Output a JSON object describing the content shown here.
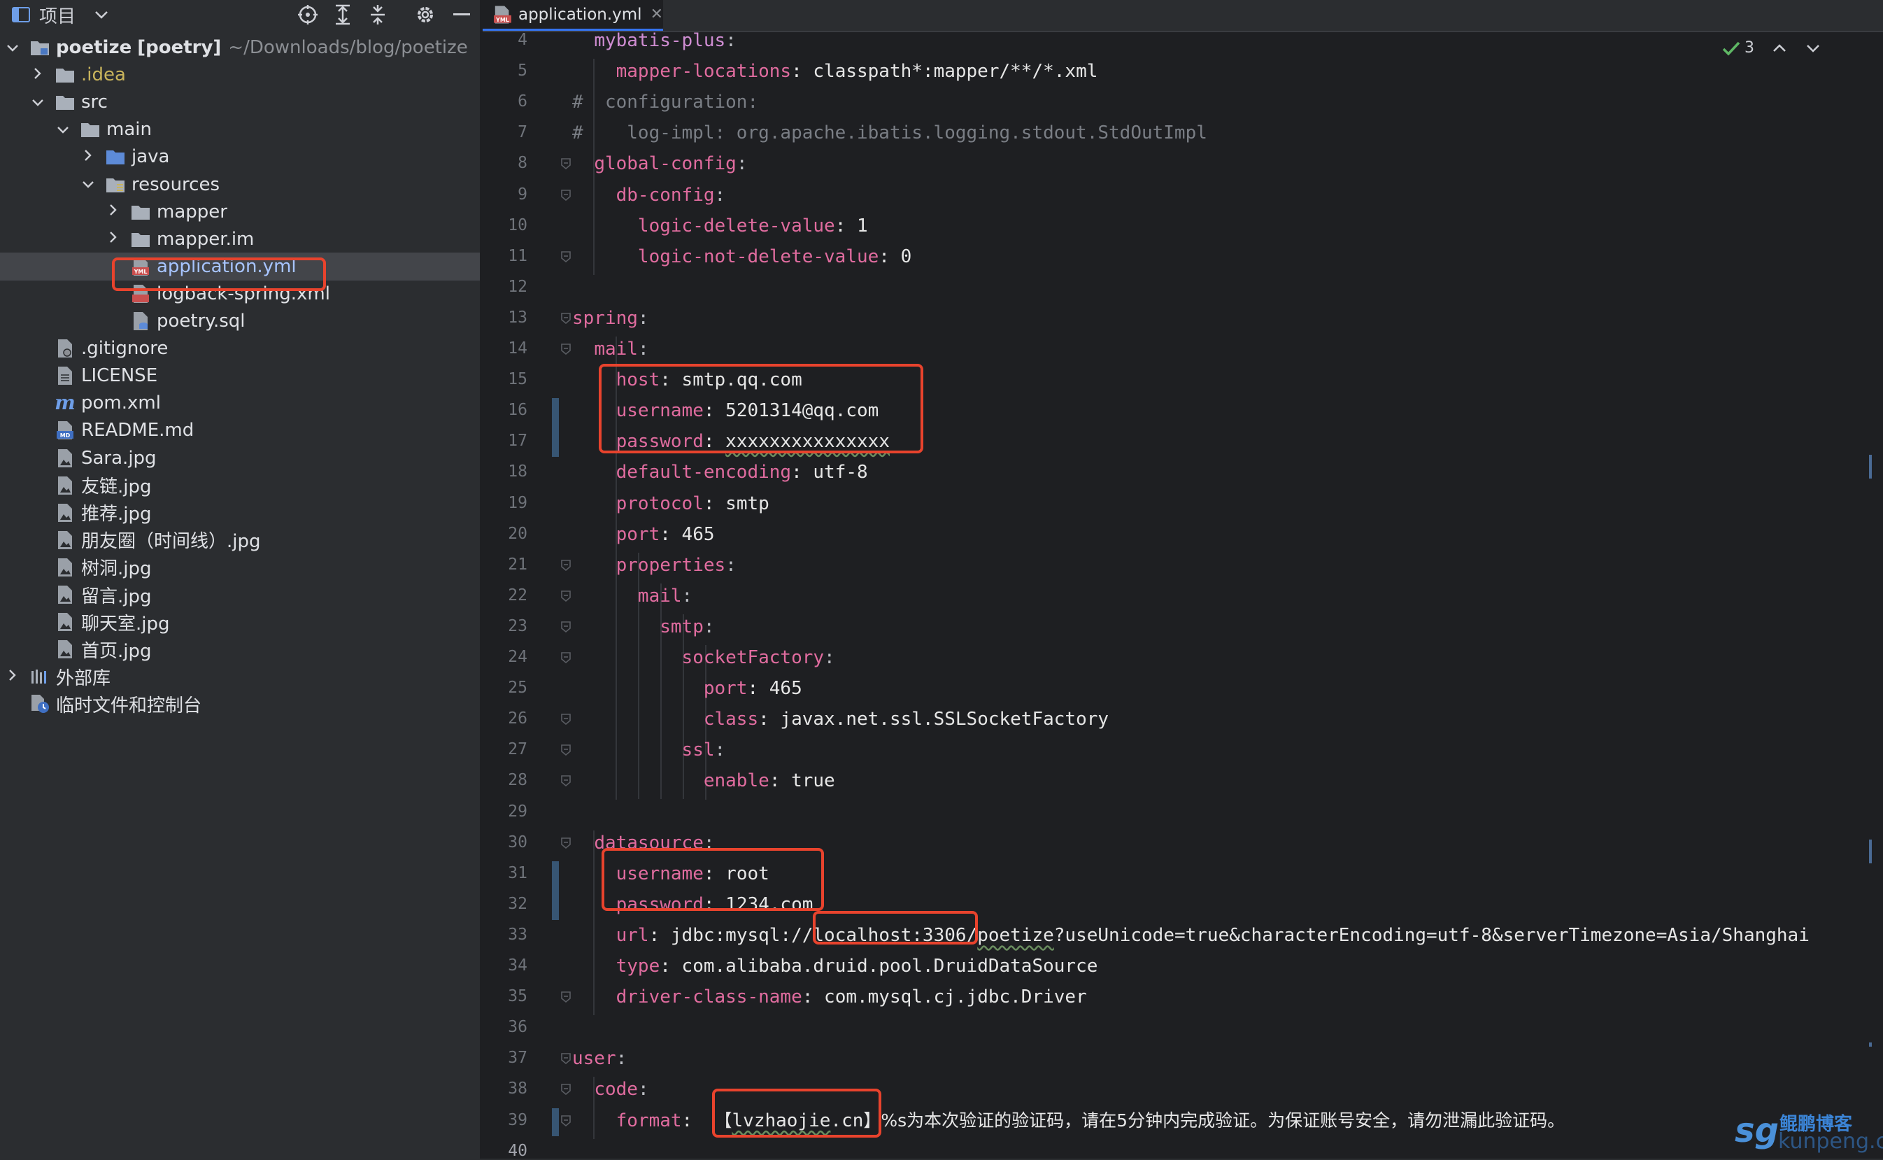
{
  "project_panel": {
    "title": "项目",
    "tree": [
      {
        "label": "poetize",
        "module": "[poetry]",
        "path": "~/Downloads/blog/poetize",
        "depth": 0,
        "expanded": true,
        "icon": "module-folder-icon"
      },
      {
        "label": ".idea",
        "depth": 1,
        "expanded": false,
        "icon": "folder-icon"
      },
      {
        "label": "src",
        "depth": 1,
        "expanded": true,
        "icon": "folder-icon"
      },
      {
        "label": "main",
        "depth": 2,
        "expanded": true,
        "icon": "folder-icon"
      },
      {
        "label": "java",
        "depth": 3,
        "expanded": false,
        "icon": "source-folder-icon"
      },
      {
        "label": "resources",
        "depth": 3,
        "expanded": true,
        "icon": "resources-folder-icon"
      },
      {
        "label": "mapper",
        "depth": 4,
        "expanded": false,
        "icon": "folder-icon"
      },
      {
        "label": "mapper.im",
        "depth": 4,
        "expanded": false,
        "icon": "folder-icon"
      },
      {
        "label": "application.yml",
        "depth": 4,
        "leaf": true,
        "icon": "yml-file-icon",
        "selected": true
      },
      {
        "label": "logback-spring.xml",
        "depth": 4,
        "leaf": true,
        "icon": "xml-file-icon"
      },
      {
        "label": "poetry.sql",
        "depth": 4,
        "leaf": true,
        "icon": "sql-file-icon"
      },
      {
        "label": ".gitignore",
        "depth": 1,
        "leaf": true,
        "icon": "gitignore-file-icon"
      },
      {
        "label": "LICENSE",
        "depth": 1,
        "leaf": true,
        "icon": "text-file-icon"
      },
      {
        "label": "pom.xml",
        "depth": 1,
        "leaf": true,
        "icon": "maven-file-icon"
      },
      {
        "label": "README.md",
        "depth": 1,
        "leaf": true,
        "icon": "markdown-file-icon"
      },
      {
        "label": "Sara.jpg",
        "depth": 1,
        "leaf": true,
        "icon": "image-file-icon"
      },
      {
        "label": "友链.jpg",
        "depth": 1,
        "leaf": true,
        "icon": "image-file-icon"
      },
      {
        "label": "推荐.jpg",
        "depth": 1,
        "leaf": true,
        "icon": "image-file-icon"
      },
      {
        "label": "朋友圈（时间线）.jpg",
        "depth": 1,
        "leaf": true,
        "icon": "image-file-icon"
      },
      {
        "label": "树洞.jpg",
        "depth": 1,
        "leaf": true,
        "icon": "image-file-icon"
      },
      {
        "label": "留言.jpg",
        "depth": 1,
        "leaf": true,
        "icon": "image-file-icon"
      },
      {
        "label": "聊天室.jpg",
        "depth": 1,
        "leaf": true,
        "icon": "image-file-icon"
      },
      {
        "label": "首页.jpg",
        "depth": 1,
        "leaf": true,
        "icon": "image-file-icon"
      },
      {
        "label": "外部库",
        "depth": 0,
        "expanded": false,
        "icon": "library-icon"
      },
      {
        "label": "临时文件和控制台",
        "depth": 0,
        "leaf": true,
        "icon": "scratch-icon"
      }
    ]
  },
  "editor": {
    "tab_label": "application.yml",
    "inspection_count": "3",
    "first_line": 4,
    "current_line": 40,
    "lines": [
      [
        {
          "t": "  ",
          "c": ""
        },
        {
          "t": "mybatis-plus",
          "c": "k"
        },
        {
          "t": ":",
          "c": ""
        }
      ],
      [
        {
          "t": "    ",
          "c": ""
        },
        {
          "t": "mapper-locations",
          "c": "k2"
        },
        {
          "t": ": classpath*:mapper/**/*.xml",
          "c": "v"
        }
      ],
      [
        {
          "t": "#  configuration:",
          "c": "c"
        }
      ],
      [
        {
          "t": "#    log-impl: org.apache.ibatis.logging.stdout.StdOutImpl",
          "c": "c"
        }
      ],
      [
        {
          "t": "  ",
          "c": ""
        },
        {
          "t": "global-config",
          "c": "k2"
        },
        {
          "t": ":",
          "c": ""
        }
      ],
      [
        {
          "t": "    ",
          "c": ""
        },
        {
          "t": "db-config",
          "c": "k2"
        },
        {
          "t": ":",
          "c": ""
        }
      ],
      [
        {
          "t": "      ",
          "c": ""
        },
        {
          "t": "logic-delete-value",
          "c": "k2"
        },
        {
          "t": ": 1",
          "c": "v"
        }
      ],
      [
        {
          "t": "      ",
          "c": ""
        },
        {
          "t": "logic-not-delete-value",
          "c": "k2"
        },
        {
          "t": ": 0",
          "c": "v"
        }
      ],
      [
        {
          "t": "",
          "c": ""
        }
      ],
      [
        {
          "t": "spring",
          "c": "k2"
        },
        {
          "t": ":",
          "c": ""
        }
      ],
      [
        {
          "t": "  ",
          "c": ""
        },
        {
          "t": "mail",
          "c": "k2"
        },
        {
          "t": ":",
          "c": ""
        }
      ],
      [
        {
          "t": "    ",
          "c": ""
        },
        {
          "t": "host",
          "c": "k2"
        },
        {
          "t": ": smtp.qq.com",
          "c": "v"
        }
      ],
      [
        {
          "t": "    ",
          "c": ""
        },
        {
          "t": "username",
          "c": "k2"
        },
        {
          "t": ": 5201314@qq.com",
          "c": "v"
        }
      ],
      [
        {
          "t": "    ",
          "c": ""
        },
        {
          "t": "password",
          "c": "k2"
        },
        {
          "t": ": ",
          "c": "v"
        },
        {
          "t": "xxxxxxxxxxxxxxx",
          "c": "v wavy"
        }
      ],
      [
        {
          "t": "    ",
          "c": ""
        },
        {
          "t": "default-encoding",
          "c": "k2"
        },
        {
          "t": ": utf-8",
          "c": "v"
        }
      ],
      [
        {
          "t": "    ",
          "c": ""
        },
        {
          "t": "protocol",
          "c": "k2"
        },
        {
          "t": ": smtp",
          "c": "v"
        }
      ],
      [
        {
          "t": "    ",
          "c": ""
        },
        {
          "t": "port",
          "c": "k2"
        },
        {
          "t": ": 465",
          "c": "v"
        }
      ],
      [
        {
          "t": "    ",
          "c": ""
        },
        {
          "t": "properties",
          "c": "k2"
        },
        {
          "t": ":",
          "c": ""
        }
      ],
      [
        {
          "t": "      ",
          "c": ""
        },
        {
          "t": "mail",
          "c": "k2"
        },
        {
          "t": ":",
          "c": ""
        }
      ],
      [
        {
          "t": "        ",
          "c": ""
        },
        {
          "t": "smtp",
          "c": "k2"
        },
        {
          "t": ":",
          "c": ""
        }
      ],
      [
        {
          "t": "          ",
          "c": ""
        },
        {
          "t": "socketFactory",
          "c": "k2"
        },
        {
          "t": ":",
          "c": ""
        }
      ],
      [
        {
          "t": "            ",
          "c": ""
        },
        {
          "t": "port",
          "c": "k2"
        },
        {
          "t": ": 465",
          "c": "v"
        }
      ],
      [
        {
          "t": "            ",
          "c": ""
        },
        {
          "t": "class",
          "c": "k2"
        },
        {
          "t": ": javax.net.ssl.SSLSocketFactory",
          "c": "v"
        }
      ],
      [
        {
          "t": "          ",
          "c": ""
        },
        {
          "t": "ssl",
          "c": "k2"
        },
        {
          "t": ":",
          "c": ""
        }
      ],
      [
        {
          "t": "            ",
          "c": ""
        },
        {
          "t": "enable",
          "c": "k2"
        },
        {
          "t": ": true",
          "c": "v"
        }
      ],
      [
        {
          "t": "",
          "c": ""
        }
      ],
      [
        {
          "t": "  ",
          "c": ""
        },
        {
          "t": "datasource",
          "c": "k2"
        },
        {
          "t": ":",
          "c": ""
        }
      ],
      [
        {
          "t": "    ",
          "c": ""
        },
        {
          "t": "username",
          "c": "k2"
        },
        {
          "t": ": root",
          "c": "v"
        }
      ],
      [
        {
          "t": "    ",
          "c": ""
        },
        {
          "t": "password",
          "c": "k2"
        },
        {
          "t": ": 1234.com",
          "c": "v"
        }
      ],
      [
        {
          "t": "    ",
          "c": ""
        },
        {
          "t": "url",
          "c": "k2"
        },
        {
          "t": ": jdbc:mysql://localhost:3306/",
          "c": "v"
        },
        {
          "t": "poetize",
          "c": "v wavy"
        },
        {
          "t": "?useUnicode=true&characterEncoding=utf-8&serverTimezone=Asia/Shanghai",
          "c": "v"
        }
      ],
      [
        {
          "t": "    ",
          "c": ""
        },
        {
          "t": "type",
          "c": "k2"
        },
        {
          "t": ": com.alibaba.druid.pool.DruidDataSource",
          "c": "v"
        }
      ],
      [
        {
          "t": "    ",
          "c": ""
        },
        {
          "t": "driver-class-name",
          "c": "k2"
        },
        {
          "t": ": com.mysql.cj.jdbc.Driver",
          "c": "v"
        }
      ],
      [
        {
          "t": "",
          "c": ""
        }
      ],
      [
        {
          "t": "user",
          "c": "k2"
        },
        {
          "t": ":",
          "c": ""
        }
      ],
      [
        {
          "t": "  ",
          "c": ""
        },
        {
          "t": "code",
          "c": "k2"
        },
        {
          "t": ":",
          "c": ""
        }
      ],
      [
        {
          "t": "    ",
          "c": ""
        },
        {
          "t": "format",
          "c": "k2"
        },
        {
          "t": ":  ",
          "c": "v"
        },
        {
          "t": "【",
          "c": "v cn"
        },
        {
          "t": "lvzhaojie",
          "c": "v wavy"
        },
        {
          "t": ".cn",
          "c": "v"
        },
        {
          "t": "】",
          "c": "v cn"
        },
        {
          "t": "%s为本次验证的验证码，请在5分钟内完成验证。为保证账号安全，请勿泄漏此验证码。",
          "c": "v cn"
        }
      ],
      [
        {
          "t": "",
          "c": ""
        }
      ]
    ]
  },
  "watermark": {
    "brand": "sg",
    "text": "鲲鹏博客",
    "domain": "kunpeng.cn"
  },
  "colors": {
    "highlight_box": "#e8432d",
    "key": "#e06c9f",
    "accent": "#3574f0"
  }
}
